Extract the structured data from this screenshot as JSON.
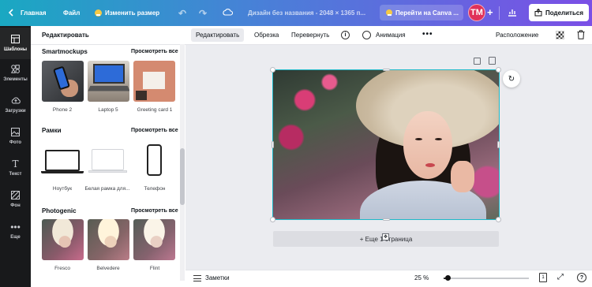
{
  "topbar": {
    "home": "Главная",
    "file": "Файл",
    "resize": "Изменить размер",
    "title": "Дизайн без названия - 2048 × 1365 п...",
    "upgrade": "Перейти на Canva ...",
    "avatar": "TM",
    "share": "Поделиться"
  },
  "rail": {
    "items": [
      {
        "label": "Шаблоны",
        "icon": "templates-icon"
      },
      {
        "label": "Элементы",
        "icon": "elements-icon"
      },
      {
        "label": "Загрузки",
        "icon": "uploads-icon"
      },
      {
        "label": "Фото",
        "icon": "photos-icon"
      },
      {
        "label": "Текст",
        "icon": "text-icon"
      },
      {
        "label": "Фон",
        "icon": "background-icon"
      },
      {
        "label": "Еще",
        "icon": "more-icon"
      }
    ]
  },
  "panel": {
    "header": "Редактировать",
    "see_all": "Просмотреть все",
    "sections": [
      {
        "title": "Smartmockups",
        "items": [
          "Phone 2",
          "Laptop 5",
          "Greeting card 1"
        ]
      },
      {
        "title": "Рамки",
        "items": [
          "Ноутбук",
          "Белая рамка для...",
          "Телефон"
        ]
      },
      {
        "title": "Photogenic",
        "items": [
          "Fresco",
          "Belvedere",
          "Flint"
        ]
      }
    ]
  },
  "toolbar": {
    "edit": "Редактировать",
    "crop": "Обрезка",
    "flip": "Перевернуть",
    "info": "i",
    "animation": "Анимация",
    "more": "•••",
    "position": "Расположение"
  },
  "canvas": {
    "add_page": "+ Еще 1 страница"
  },
  "bottombar": {
    "notes": "Заметки",
    "zoom": "25 %",
    "zoom_level": 0.25,
    "pages": "1",
    "help": "?"
  },
  "colors": {
    "accent": "#1fb9c9",
    "topbar_start": "#1aa8c2",
    "topbar_end": "#7b4fe6",
    "avatar": "#e0315a"
  }
}
